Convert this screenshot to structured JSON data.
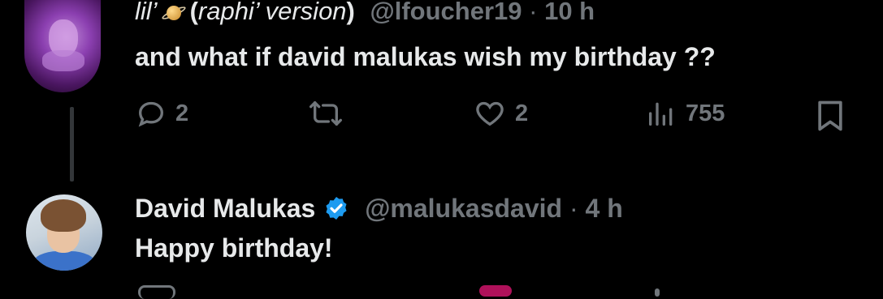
{
  "tweet1": {
    "name_prefix": "lil’",
    "name_suffix": "(raphi’ version)",
    "handle": "@lfoucher19",
    "separator": "·",
    "time": "10 h",
    "text": "and what if david malukas wish my birthday ??",
    "actions": {
      "replies": "2",
      "retweets": "",
      "likes": "2",
      "views": "755"
    },
    "icons": [
      "reply-icon",
      "retweet-icon",
      "like-icon",
      "views-icon",
      "bookmark-icon"
    ]
  },
  "tweet2": {
    "name": "David Malukas",
    "handle": "@malukasdavid",
    "separator": "·",
    "time": "4 h",
    "text": "Happy birthday!",
    "verified": true
  },
  "colors": {
    "background": "#000000",
    "text": "#e7e9ea",
    "muted": "#71767b",
    "verified": "#1d9bf0",
    "thread_line": "#333639"
  }
}
